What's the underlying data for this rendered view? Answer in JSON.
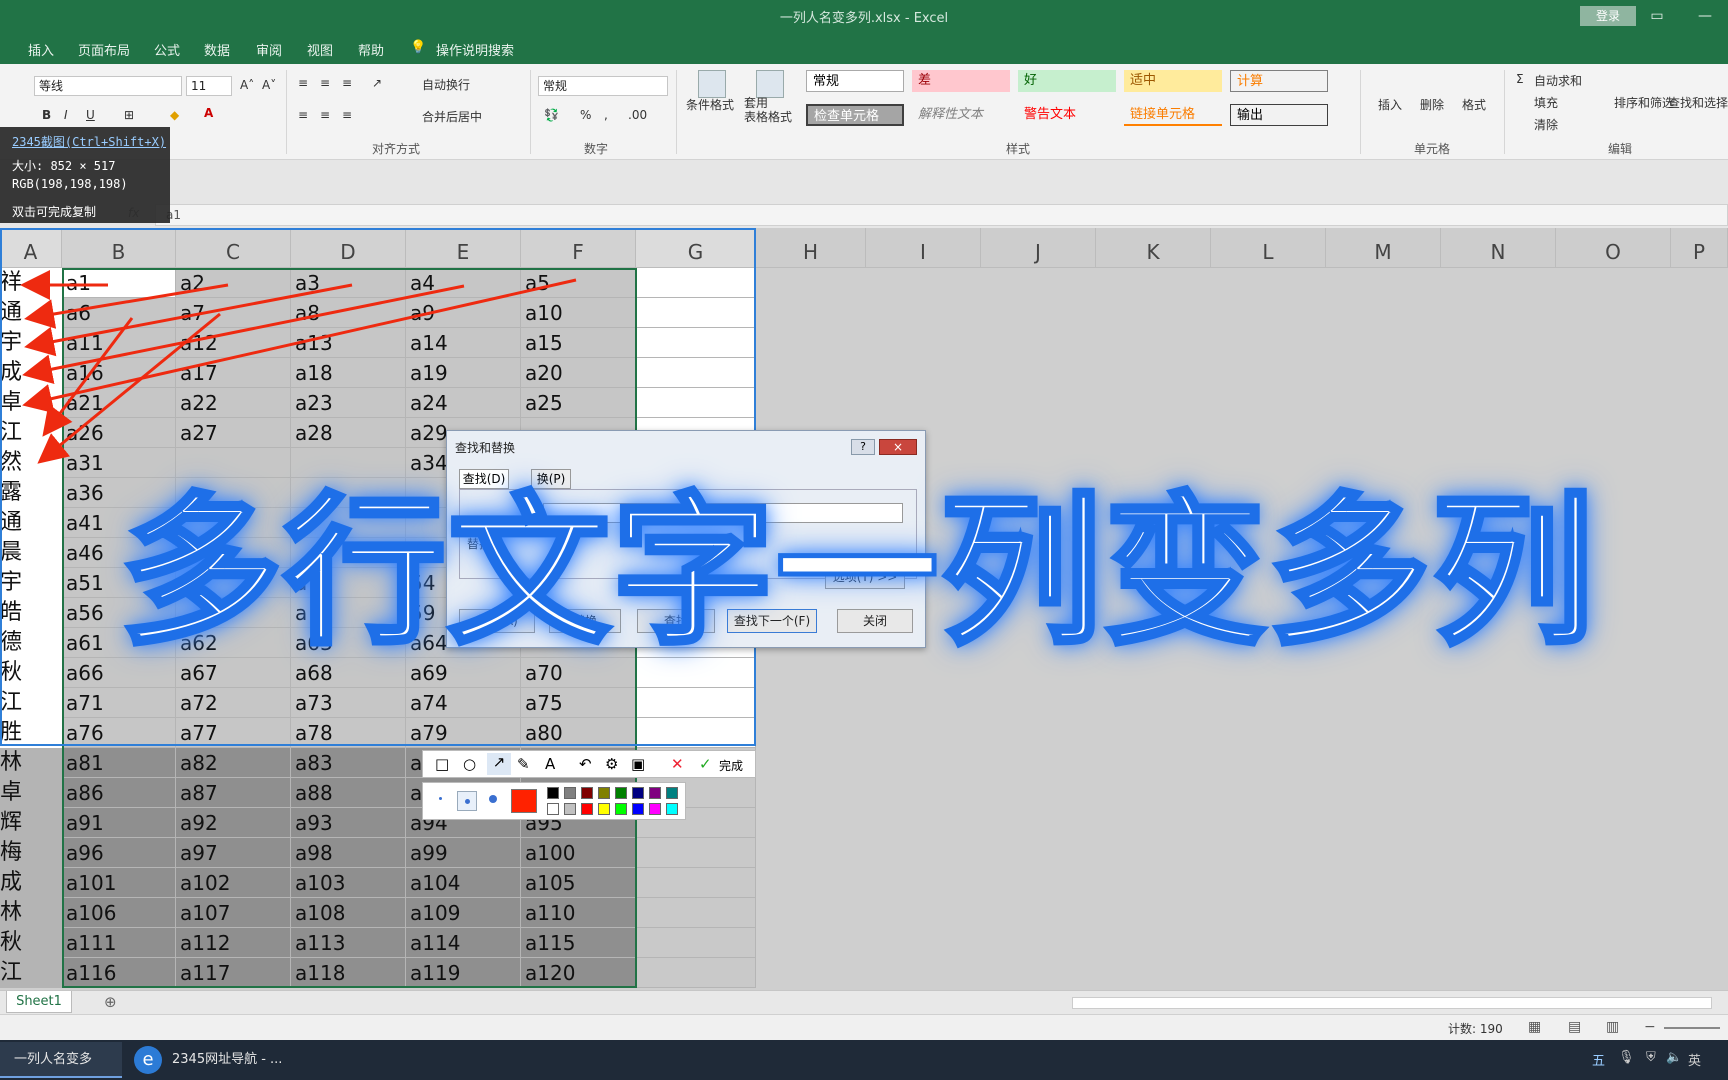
{
  "window": {
    "title": "一列人名变多列.xlsx  -  Excel",
    "login_label": "登录"
  },
  "ribbon_tabs": [
    "插入",
    "页面布局",
    "公式",
    "数据",
    "审阅",
    "视图",
    "帮助",
    "操作说明搜索"
  ],
  "ribbon": {
    "font_name": "等线",
    "font_size": "11",
    "wrap_text": "自动换行",
    "merge_center": "合并后居中",
    "number_format": "常规",
    "conditional_format": "条件格式",
    "format_table": "套用\n表格格式",
    "styles": [
      "常规",
      "差",
      "好",
      "适中",
      "计算",
      "检查单元格",
      "解释性文本",
      "警告文本",
      "链接单元格",
      "输出"
    ],
    "cells_group": [
      "插入",
      "删除",
      "格式"
    ],
    "editing": [
      "自动求和",
      "填充",
      "清除",
      "排序和筛选",
      "查找和选择"
    ],
    "group_labels": {
      "alignment": "对齐方式",
      "number": "数字",
      "styles": "样式",
      "cells": "单元格",
      "editing": "编辑"
    }
  },
  "snip_tooltip": {
    "title": "2345截图(Ctrl+Shift+X)",
    "size": "大小: 852 × 517",
    "rgb": "RGB(198,198,198)",
    "hint": "双击可完成复制"
  },
  "formula_bar": {
    "fx": "fx",
    "value": "a1"
  },
  "columns": [
    "A",
    "B",
    "C",
    "D",
    "E",
    "F",
    "G",
    "H",
    "I",
    "J",
    "K",
    "L",
    "M",
    "N",
    "O",
    "P"
  ],
  "col_a_names": [
    "祥",
    "通",
    "宇",
    "成",
    "卓",
    "江",
    "然",
    "露",
    "通",
    "晨",
    "宇",
    "皓",
    "德",
    "秋",
    "江",
    "胜",
    "林",
    "卓",
    "辉",
    "梅",
    "成",
    "林",
    "秋",
    "江"
  ],
  "grid_rows": [
    [
      "a1",
      "a2",
      "a3",
      "a4",
      "a5"
    ],
    [
      "a6",
      "a7",
      "a8",
      "a9",
      "a10"
    ],
    [
      "a11",
      "a12",
      "a13",
      "a14",
      "a15"
    ],
    [
      "a16",
      "a17",
      "a18",
      "a19",
      "a20"
    ],
    [
      "a21",
      "a22",
      "a23",
      "a24",
      "a25"
    ],
    [
      "a26",
      "a27",
      "a28",
      "a29",
      ""
    ],
    [
      "a31",
      "",
      "",
      "a34",
      ""
    ],
    [
      "a36",
      "",
      "",
      "",
      ""
    ],
    [
      "a41",
      "",
      "",
      "",
      ""
    ],
    [
      "a46",
      "",
      "",
      "49",
      ""
    ],
    [
      "a51",
      "",
      "a",
      "54",
      ""
    ],
    [
      "a56",
      "",
      "a",
      "59",
      ""
    ],
    [
      "a61",
      "a62",
      "a63",
      "a64",
      ""
    ],
    [
      "a66",
      "a67",
      "a68",
      "a69",
      "a70"
    ],
    [
      "a71",
      "a72",
      "a73",
      "a74",
      "a75"
    ],
    [
      "a76",
      "a77",
      "a78",
      "a79",
      "a80"
    ],
    [
      "a81",
      "a82",
      "a83",
      "a",
      ""
    ],
    [
      "a86",
      "a87",
      "a88",
      "a",
      ""
    ],
    [
      "a91",
      "a92",
      "a93",
      "a94",
      "a95"
    ],
    [
      "a96",
      "a97",
      "a98",
      "a99",
      "a100"
    ],
    [
      "a101",
      "a102",
      "a103",
      "a104",
      "a105"
    ],
    [
      "a106",
      "a107",
      "a108",
      "a109",
      "a110"
    ],
    [
      "a111",
      "a112",
      "a113",
      "a114",
      "a115"
    ],
    [
      "a116",
      "a117",
      "a118",
      "a119",
      "a120"
    ]
  ],
  "dialog": {
    "title": "查找和替换",
    "tab_find": "查找(D)",
    "tab_replace": "换(P)",
    "replace_label": "替换",
    "options_btn": "选项(T) >>",
    "replace_all": "替换(A)",
    "replace": "替换",
    "find_all": "查找",
    "find_next": "查找下一个(F)",
    "close": "关闭",
    "help": "?",
    "x": "×"
  },
  "overlay_title": "多行文字一列变多列",
  "snip_toolbar": {
    "done": "完成"
  },
  "palette_colors": [
    "#000000",
    "#808080",
    "#800000",
    "#808000",
    "#008000",
    "#000080",
    "#800080",
    "#008080",
    "#ffffff",
    "#c0c0c0",
    "#ff0000",
    "#ffff00",
    "#00ff00",
    "#0000ff",
    "#ff00ff",
    "#00ffff"
  ],
  "accent_color": "#ff2200",
  "sheet_tab": "Sheet1",
  "status": {
    "count": "计数: 190"
  },
  "taskbar": {
    "excel": "一列人名变多列.x...",
    "browser": "2345网址导航 - ...",
    "tray": [
      "五",
      "英"
    ]
  }
}
